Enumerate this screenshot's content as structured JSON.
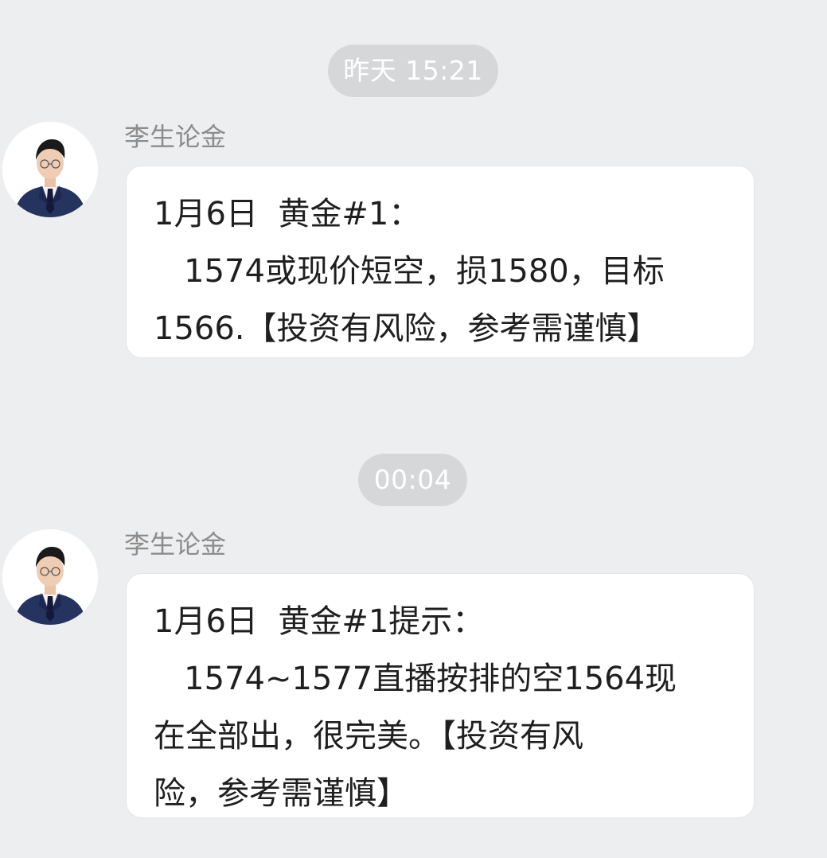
{
  "chat": {
    "messages": [
      {
        "timestamp": "昨天 15:21",
        "sender": "李生论金",
        "lines": [
          "1月6日  黄金#1：",
          "   1574或现价短空，损1580，目标",
          "1566.【投资有风险，参考需谨慎】"
        ]
      },
      {
        "timestamp": "00:04",
        "sender": "李生论金",
        "lines": [
          "1月6日  黄金#1提示：",
          "   1574~1577直播按排的空1564现",
          "在全部出，很完美。【投资有风",
          "险，参考需谨慎】"
        ]
      }
    ]
  },
  "colors": {
    "background": "#edeeef",
    "bubble": "#ffffff",
    "time_pill": "#d6d7d9",
    "sender_text": "#8c8c8c",
    "message_text": "#1f1f1f"
  },
  "icons": {
    "avatar": "avatar-portrait-icon"
  }
}
